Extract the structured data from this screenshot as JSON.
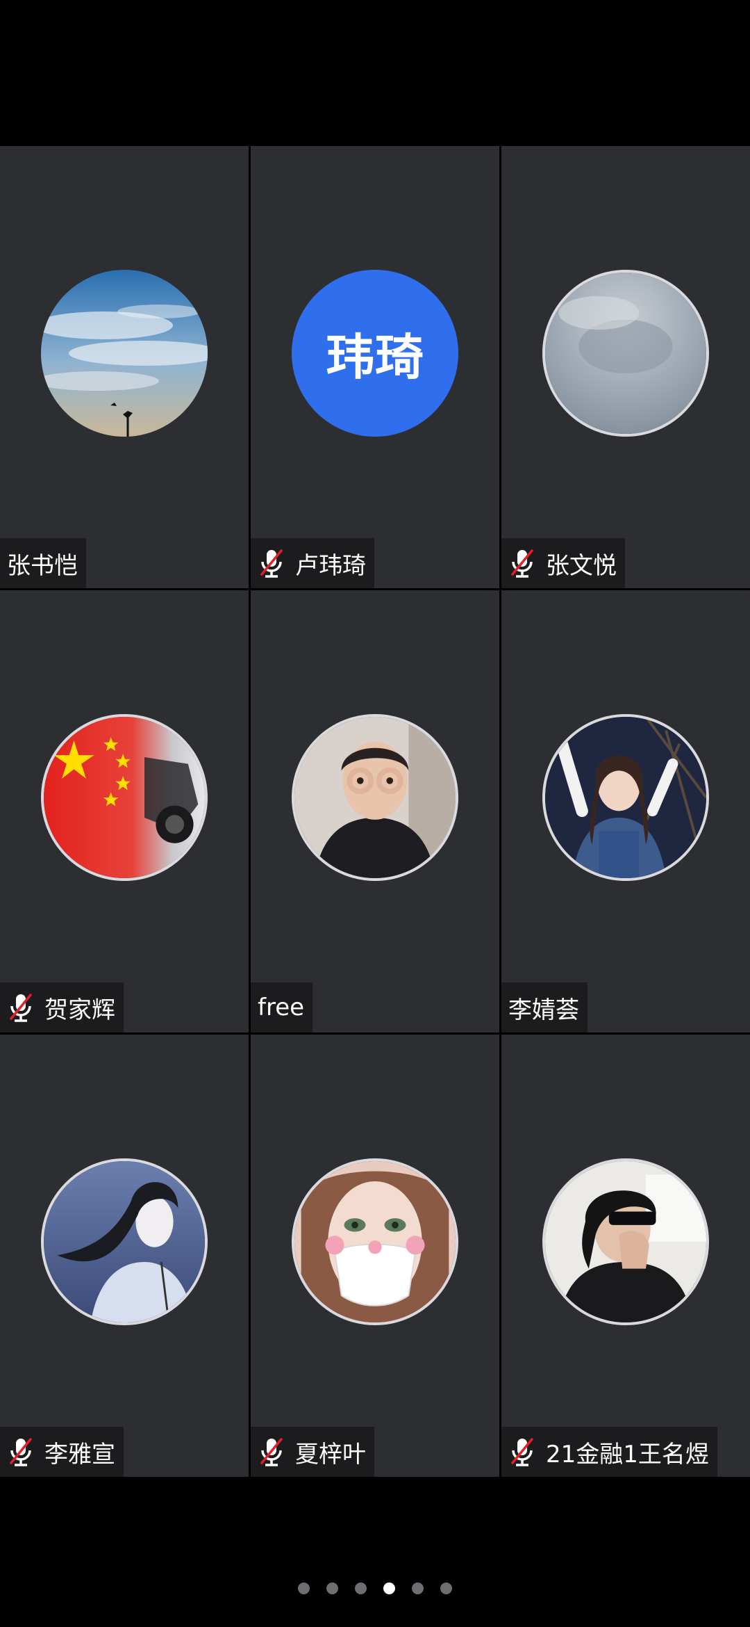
{
  "participants": [
    {
      "name": "张书恺",
      "muted": false,
      "avatar": "sky-photo"
    },
    {
      "name": "卢玮琦",
      "muted": true,
      "avatar": "text",
      "avatar_text": "玮琦",
      "avatar_color": "#2f6fee"
    },
    {
      "name": "张文悦",
      "muted": true,
      "avatar": "cloudy-photo"
    },
    {
      "name": "贺家辉",
      "muted": true,
      "avatar": "flag-motorcycle-photo"
    },
    {
      "name": "free",
      "muted": false,
      "avatar": "person-photo"
    },
    {
      "name": "李婧荟",
      "muted": false,
      "avatar": "girl-photo"
    },
    {
      "name": "李雅宣",
      "muted": true,
      "avatar": "anime-girl-photo"
    },
    {
      "name": "夏梓叶",
      "muted": true,
      "avatar": "masked-girl-photo"
    },
    {
      "name": "21金融1王名煜",
      "muted": true,
      "avatar": "sunglasses-person-photo"
    }
  ],
  "pagination": {
    "pages": 6,
    "current": 4
  },
  "colors": {
    "tile_bg": "#2d2e32",
    "name_tag_bg": "#1c1c1e",
    "mute_slash": "#e0202a"
  }
}
